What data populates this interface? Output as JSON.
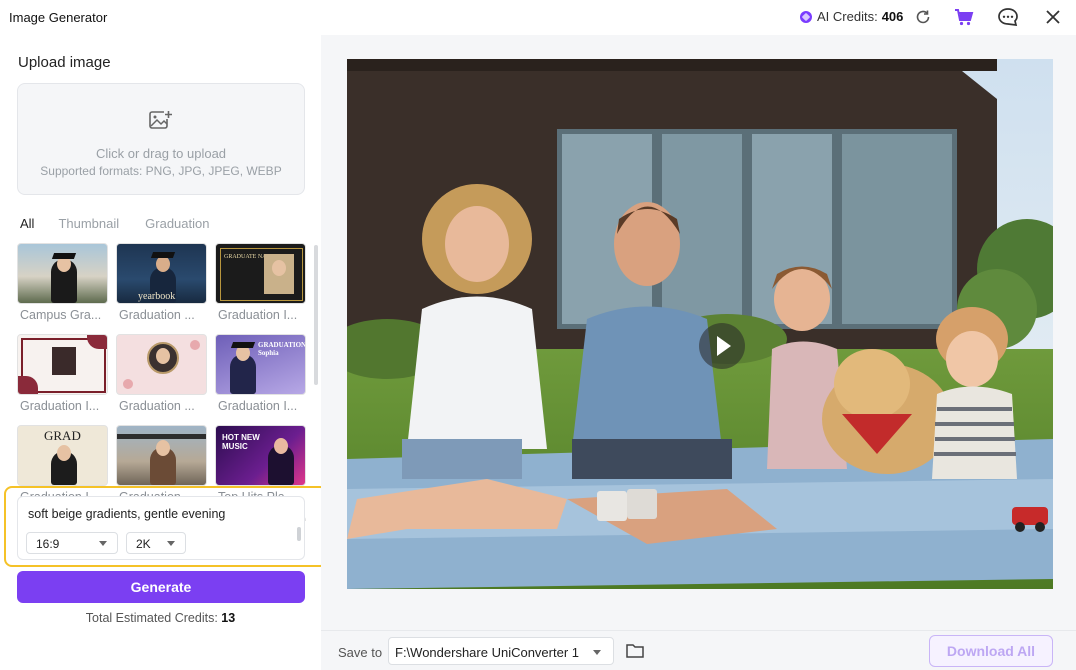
{
  "window": {
    "title": "Image Generator",
    "credits_label": "AI Credits:",
    "credits_value": "406",
    "icons": [
      "credits-gem-icon",
      "refresh-icon",
      "cart-icon",
      "chat-icon",
      "close-icon"
    ]
  },
  "upload": {
    "title": "Upload image",
    "hint": "Click or drag to upload",
    "formats": "Supported formats: PNG, JPG, JPEG, WEBP"
  },
  "tabs": [
    {
      "label": "All",
      "active": true
    },
    {
      "label": "Thumbnail",
      "active": false
    },
    {
      "label": "Graduation",
      "active": false
    }
  ],
  "templates": [
    {
      "caption": "Campus Gra..."
    },
    {
      "caption": "Graduation ...",
      "thumb_text": "yearbook"
    },
    {
      "caption": "Graduation I...",
      "thumb_text": "GRADUATE NAME"
    },
    {
      "caption": "Graduation I..."
    },
    {
      "caption": "Graduation ..."
    },
    {
      "caption": "Graduation I...",
      "thumb_text": "GRADUATION Sophia"
    },
    {
      "caption": "Graduation I...",
      "thumb_text": "GRAD"
    },
    {
      "caption": "Graduation ..."
    },
    {
      "caption": "Top Hits Pla...",
      "thumb_text": "HOT NEW MUSIC"
    }
  ],
  "prompt": {
    "text": "soft beige gradients, gentle evening",
    "aspect_ratio": "16:9",
    "resolution": "2K"
  },
  "generate_label": "Generate",
  "total": {
    "label": "Total Estimated Credits:",
    "value": "13"
  },
  "footer": {
    "save_label": "Save to",
    "path": "F:\\Wondershare UniConverter 1",
    "download_all_label": "Download All"
  },
  "colors": {
    "accent": "#7b3ff2",
    "highlight_border": "#f5c227",
    "panel_bg": "#f5f6f8"
  }
}
